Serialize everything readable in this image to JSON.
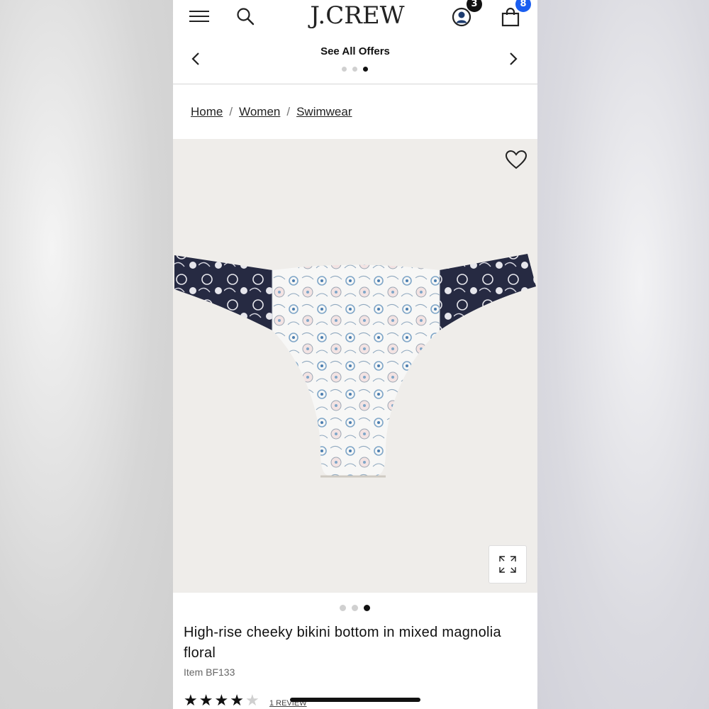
{
  "header": {
    "logo": "J.CREW",
    "account_badge": "3",
    "bag_badge": "8"
  },
  "offers": {
    "label": "See All Offers",
    "carousel_pages": 3,
    "active_page": 3
  },
  "breadcrumb": {
    "items": [
      "Home",
      "Women",
      "Swimwear"
    ],
    "separator": "/"
  },
  "product": {
    "image_carousel_pages": 3,
    "image_active_page": 3,
    "title": "High-rise cheeky bikini bottom in mixed magnolia floral",
    "item_number": "Item BF133",
    "rating": 4,
    "rating_max": 5,
    "review_link": "1 REVIEW"
  },
  "colors": {
    "bag_badge": "#1a5ef0",
    "account_badge": "#111111",
    "image_background": "#efedea"
  }
}
